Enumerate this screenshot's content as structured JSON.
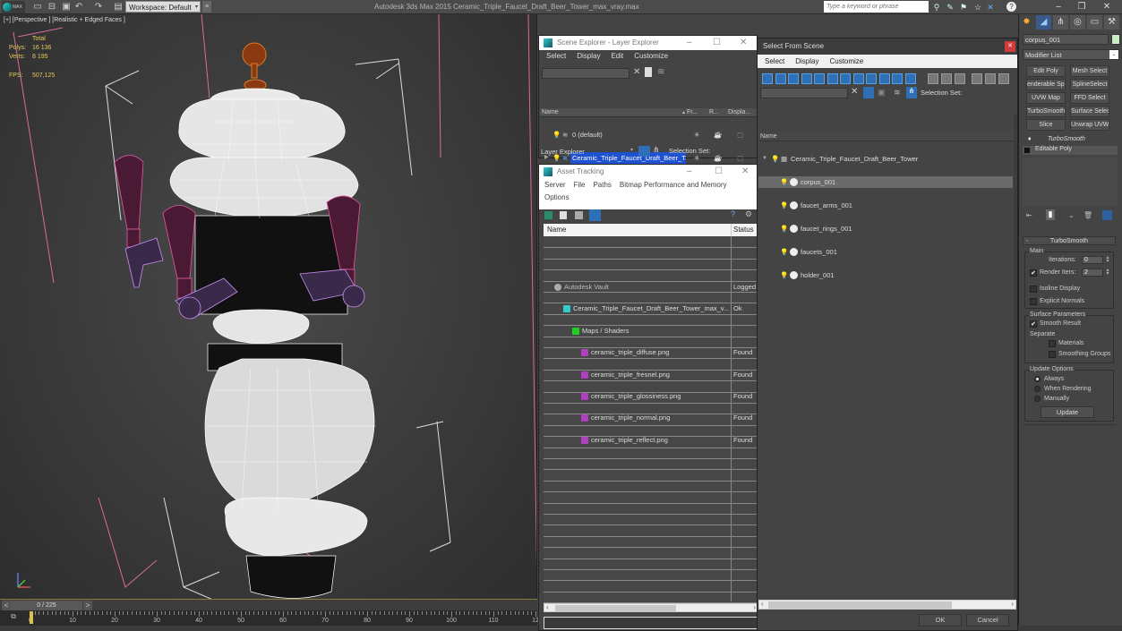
{
  "app": {
    "title": "Autodesk 3ds Max  2015     Ceramic_Triple_Faucet_Draft_Beer_Tower_max_vray.max",
    "logo_text": "MAX",
    "workspace": "Workspace: Default",
    "search_placeholder": "Type a keyword or phrase",
    "toolbar_icons": [
      "new-file-icon",
      "open-file-icon",
      "save-icon",
      "undo-icon",
      "redo-icon",
      "project-folder-icon"
    ],
    "help_icons": [
      "binoculars-icon",
      "wrench-icon",
      "satellite-icon",
      "star-icon",
      "x-icon",
      "help-icon"
    ],
    "window_controls": [
      "minimize",
      "restore",
      "close"
    ]
  },
  "viewport": {
    "label": "[+] [Perspective ] [Realistic + Edged Faces ]",
    "stats": {
      "header": "Total",
      "polys_label": "Polys:",
      "polys_value": "16 136",
      "verts_label": "Verts:",
      "verts_value": "8 195",
      "fps_label": "FPS:",
      "fps_value": "507,125"
    }
  },
  "timeline": {
    "prev": "<",
    "next": ">",
    "frame": "0 / 225",
    "current_frame": 0,
    "total_frames": 225,
    "ruler_labels": [
      "0",
      "10",
      "20",
      "30",
      "40",
      "50",
      "60",
      "70",
      "80",
      "90",
      "100",
      "110",
      "12"
    ]
  },
  "scene_explorer": {
    "title": "Scene Explorer - Layer Explorer",
    "menu": [
      "Select",
      "Display",
      "Edit",
      "Customize"
    ],
    "columns": [
      "Name",
      "Fr...",
      "R...",
      "Displa..."
    ],
    "rows": [
      {
        "name": "0 (default)",
        "selected": false
      },
      {
        "name": "Ceramic_Triple_Faucet_Draft_Beer_T...",
        "selected": true
      }
    ],
    "footer_dropdown": "Layer Explorer",
    "selection_set_label": "Selection Set:"
  },
  "asset_tracking": {
    "title": "Asset Tracking",
    "menu": [
      "Server",
      "File",
      "Paths",
      "Bitmap Performance and Memory"
    ],
    "menu2": [
      "Options"
    ],
    "columns": [
      "Name",
      "Status"
    ],
    "rows": [
      {
        "name": "Autodesk Vault",
        "status": "Logged",
        "indent": 1,
        "icon": "vault-icon"
      },
      {
        "name": "Ceramic_Triple_Faucet_Draft_Beer_Tower_max_v...",
        "status": "Ok",
        "indent": 2,
        "icon": "max-file-icon"
      },
      {
        "name": "Maps / Shaders",
        "status": "",
        "indent": 3,
        "icon": "maps-icon"
      },
      {
        "name": "ceramic_triple_diffuse.png",
        "status": "Found",
        "indent": 4,
        "icon": "png-icon"
      },
      {
        "name": "ceramic_triple_fresnel.png",
        "status": "Found",
        "indent": 4,
        "icon": "png-icon"
      },
      {
        "name": "ceramic_triple_glossiness.png",
        "status": "Found",
        "indent": 4,
        "icon": "png-icon"
      },
      {
        "name": "ceramic_triple_normal.png",
        "status": "Found",
        "indent": 4,
        "icon": "png-icon"
      },
      {
        "name": "ceramic_triple_reflect.png",
        "status": "Found",
        "indent": 4,
        "icon": "png-icon"
      }
    ]
  },
  "select_from_scene": {
    "title": "Select From Scene",
    "menu": [
      "Select",
      "Display",
      "Customize"
    ],
    "selection_set_label": "Selection Set:",
    "column": "Name",
    "root": "Ceramic_Triple_Faucet_Draft_Beer_Tower",
    "objects": [
      {
        "name": "corpus_001",
        "selected": true
      },
      {
        "name": "faucet_arms_001",
        "selected": false
      },
      {
        "name": "faucet_rings_001",
        "selected": false
      },
      {
        "name": "faucets_001",
        "selected": false
      },
      {
        "name": "holder_001",
        "selected": false
      }
    ],
    "ok": "OK",
    "cancel": "Cancel"
  },
  "command_panel": {
    "tabs": [
      "create",
      "modify",
      "hierarchy",
      "motion",
      "display",
      "utilities"
    ],
    "object_name": "corpus_001",
    "object_color": "#c8ecc0",
    "modifier_list": "Modifier List",
    "modifier_buttons": [
      "Edit Poly",
      "Mesh Select",
      "enderable Spli",
      "SplineSelect",
      "UVW Map",
      "FFD Select",
      "TurboSmooth",
      "Surface Select",
      "Slice",
      "Unwrap UVW"
    ],
    "stack": [
      {
        "name": "TurboSmooth",
        "italic": true
      },
      {
        "name": "Editable Poly",
        "italic": false
      }
    ],
    "rollout_title": "TurboSmooth",
    "main_group": "Main",
    "iterations_label": "Iterations:",
    "iterations_value": "0",
    "render_iters_label": "Render Iters:",
    "render_iters_value": "2",
    "render_iters_checked": true,
    "isoline_label": "Isoline Display",
    "explicit_normals_label": "Explicit Normals",
    "surface_group": "Surface Parameters",
    "smooth_result_label": "Smooth Result",
    "separate_label": "Separate",
    "materials_label": "Materials",
    "smoothing_groups_label": "Smoothing Groups",
    "update_group": "Update Options",
    "update_options": [
      "Always",
      "When Rendering",
      "Manually"
    ],
    "update_selected": "Always",
    "update_button": "Update"
  }
}
